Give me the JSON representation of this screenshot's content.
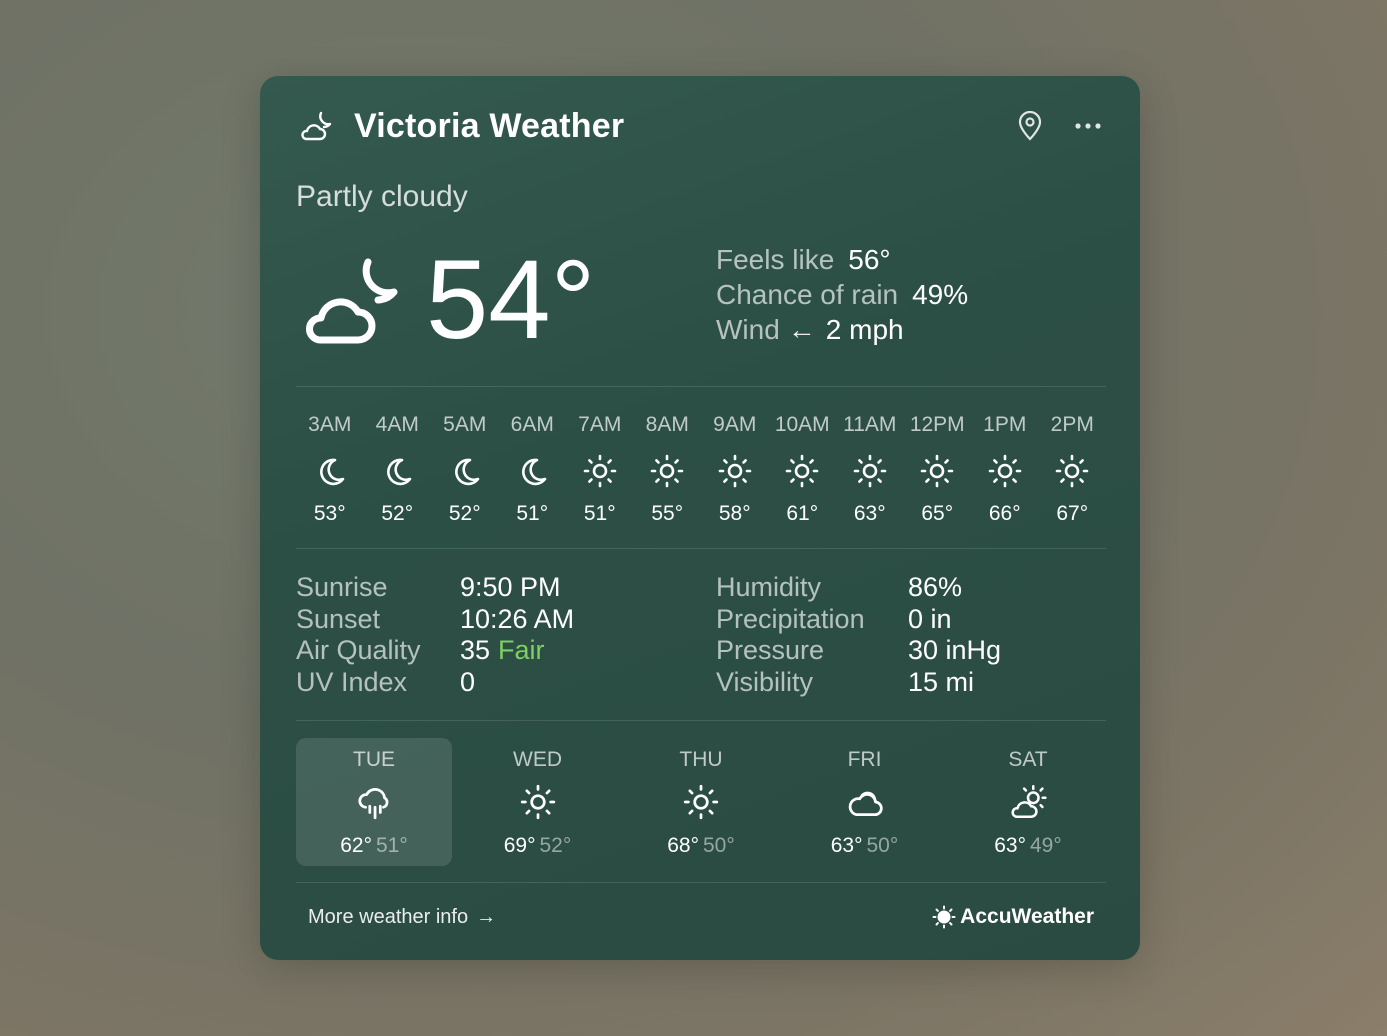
{
  "header": {
    "title": "Victoria Weather",
    "app_icon": "cloud-moon-icon",
    "location_icon": "location-pin-icon",
    "more_icon": "more-horizontal-icon"
  },
  "current": {
    "condition": "Partly cloudy",
    "temperature": "54°",
    "icon": "cloud-moon-icon",
    "feels_like_label": "Feels like",
    "feels_like_value": "56°",
    "rain_label": "Chance of rain",
    "rain_value": "49%",
    "wind_label": "Wind",
    "wind_arrow": "←",
    "wind_value": "2 mph"
  },
  "hourly": [
    {
      "time": "3AM",
      "icon": "moon",
      "temp": "53°"
    },
    {
      "time": "4AM",
      "icon": "moon",
      "temp": "52°"
    },
    {
      "time": "5AM",
      "icon": "moon",
      "temp": "52°"
    },
    {
      "time": "6AM",
      "icon": "moon",
      "temp": "51°"
    },
    {
      "time": "7AM",
      "icon": "sun",
      "temp": "51°"
    },
    {
      "time": "8AM",
      "icon": "sun",
      "temp": "55°"
    },
    {
      "time": "9AM",
      "icon": "sun",
      "temp": "58°"
    },
    {
      "time": "10AM",
      "icon": "sun",
      "temp": "61°"
    },
    {
      "time": "11AM",
      "icon": "sun",
      "temp": "63°"
    },
    {
      "time": "12PM",
      "icon": "sun",
      "temp": "65°"
    },
    {
      "time": "1PM",
      "icon": "sun",
      "temp": "66°"
    },
    {
      "time": "2PM",
      "icon": "sun",
      "temp": "67°"
    }
  ],
  "stats_left": {
    "sunrise_label": "Sunrise",
    "sunrise_value": "9:50 PM",
    "sunset_label": "Sunset",
    "sunset_value": "10:26 AM",
    "air_label": "Air Quality",
    "air_value": "35",
    "air_rating": "Fair",
    "uv_label": "UV Index",
    "uv_value": "0"
  },
  "stats_right": {
    "humidity_label": "Humidity",
    "humidity_value": "86%",
    "precip_label": "Precipitation",
    "precip_value": "0 in",
    "pressure_label": "Pressure",
    "pressure_value": "30 inHg",
    "visibility_label": "Visibility",
    "visibility_value": "15 mi"
  },
  "daily": [
    {
      "day": "TUE",
      "icon": "rain",
      "hi": "62°",
      "lo": "51°",
      "selected": true
    },
    {
      "day": "WED",
      "icon": "sun",
      "hi": "69°",
      "lo": "52°",
      "selected": false
    },
    {
      "day": "THU",
      "icon": "sun",
      "hi": "68°",
      "lo": "50°",
      "selected": false
    },
    {
      "day": "FRI",
      "icon": "cloud",
      "hi": "63°",
      "lo": "50°",
      "selected": false
    },
    {
      "day": "SAT",
      "icon": "partly-sunny",
      "hi": "63°",
      "lo": "49°",
      "selected": false
    }
  ],
  "footer": {
    "more_link": "More weather info",
    "more_arrow": "→",
    "brand": "AccuWeather"
  },
  "colors": {
    "card": "#2c4f45",
    "fair": "#7fcf62"
  }
}
